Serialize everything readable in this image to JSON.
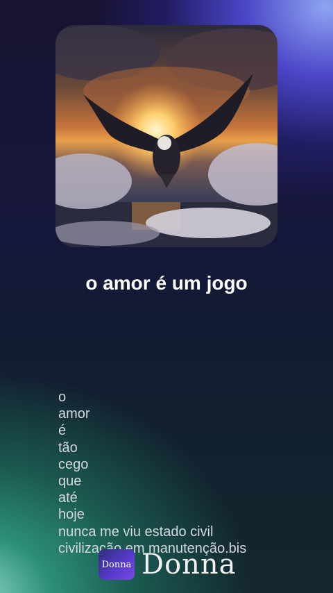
{
  "cover": {
    "icon": "eagle-sunset-artwork"
  },
  "song": {
    "title": "o amor é um jogo"
  },
  "lyrics": {
    "lines": [
      "o",
      "amor",
      "é",
      "tão",
      "cego",
      "que",
      "até",
      "hoje",
      "nunca me viu estado civil",
      "civilização em manutenção.bis"
    ]
  },
  "brand": {
    "icon_label": "Donna",
    "name": "Donna"
  },
  "colors": {
    "title": "#ffffff",
    "lyrics": "#d4d8e0",
    "accent": "#5a3bd0"
  }
}
